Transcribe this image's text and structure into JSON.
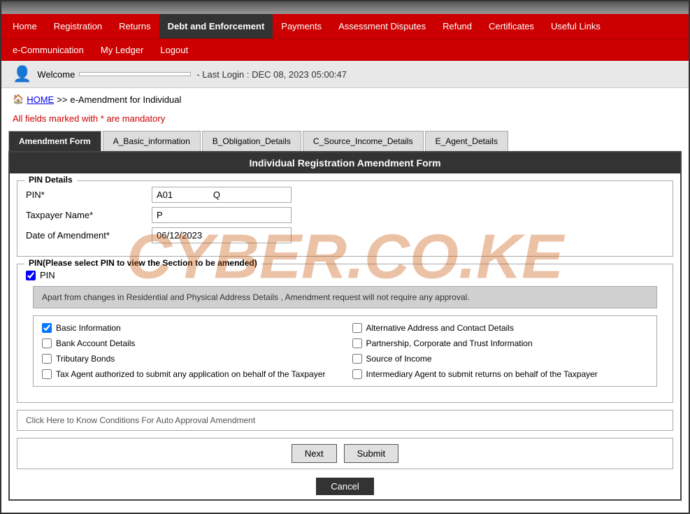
{
  "topBar": {},
  "nav": {
    "items": [
      {
        "label": "Home",
        "active": false
      },
      {
        "label": "Registration",
        "active": false
      },
      {
        "label": "Returns",
        "active": false
      },
      {
        "label": "Debt and Enforcement",
        "active": true
      },
      {
        "label": "Payments",
        "active": false
      },
      {
        "label": "Assessment Disputes",
        "active": false
      },
      {
        "label": "Refund",
        "active": false
      },
      {
        "label": "Certificates",
        "active": false
      },
      {
        "label": "Useful Links",
        "active": false
      }
    ],
    "subItems": [
      {
        "label": "e-Communication"
      },
      {
        "label": "My Ledger"
      },
      {
        "label": "Logout"
      }
    ]
  },
  "welcomeBar": {
    "welcomeLabel": "Welcome",
    "username": "",
    "lastLogin": "- Last Login : DEC 08, 2023 05:00:47"
  },
  "breadcrumb": {
    "home": "HOME",
    "separator": ">>",
    "current": "e-Amendment for Individual"
  },
  "mandatoryNote": "All fields marked with * are mandatory",
  "tabs": [
    {
      "label": "Amendment Form",
      "active": true
    },
    {
      "label": "A_Basic_information",
      "active": false
    },
    {
      "label": "B_Obligation_Details",
      "active": false
    },
    {
      "label": "C_Source_Income_Details",
      "active": false
    },
    {
      "label": "E_Agent_Details",
      "active": false
    }
  ],
  "formTitle": "Individual Registration Amendment Form",
  "pinDetails": {
    "sectionLabel": "PIN Details",
    "pinLabel": "PIN*",
    "pinValue": "A01                Q",
    "taxpayerLabel": "Taxpayer Name*",
    "taxpayerValue": "P",
    "dateLabel": "Date of Amendment*",
    "dateValue": "06/12/2023"
  },
  "pinSection": {
    "sectionLabel": "PIN(Please select PIN to view the Section to be amended)",
    "pinCheckLabel": "PIN",
    "pinChecked": true
  },
  "noticeText": "Apart from changes in Residential and Physical Address Details , Amendment request will not require any approval.",
  "checkboxes": {
    "left": [
      {
        "label": "Basic Information",
        "checked": true
      },
      {
        "label": "Bank Account Details",
        "checked": false
      },
      {
        "label": "Tributary Bonds",
        "checked": false
      },
      {
        "label": "Tax Agent authorized to submit any application on behalf of the Taxpayer",
        "checked": false
      }
    ],
    "right": [
      {
        "label": "Alternative Address and Contact Details",
        "checked": false
      },
      {
        "label": "Partnership, Corporate and Trust Information",
        "checked": false
      },
      {
        "label": "Source of Income",
        "checked": false
      },
      {
        "label": "Intermediary Agent to submit returns on behalf of the Taxpayer",
        "checked": false
      }
    ]
  },
  "infoLink": "Click Here to Know Conditions For Auto Approval Amendment",
  "buttons": {
    "next": "Next",
    "submit": "Submit",
    "cancel": "Cancel"
  },
  "watermark": "CYBER.CO.KE"
}
